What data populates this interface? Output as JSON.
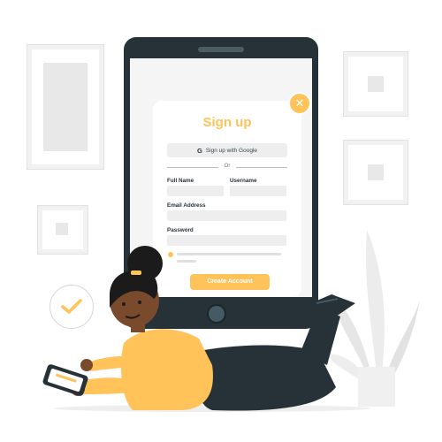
{
  "signup": {
    "title": "Sign up",
    "close_symbol": "✕",
    "google_button_label": "Sign up with Google",
    "google_icon_letter": "G",
    "divider_text": "Or",
    "full_name_label": "Full Name",
    "username_label": "Username",
    "email_label": "Email Address",
    "password_label": "Password",
    "create_button_label": "Create Account"
  },
  "colors": {
    "accent": "#ffc35a",
    "tablet": "#263238",
    "skin": "#7a4a2c",
    "shirt": "#ffc35a",
    "pants": "#263238"
  },
  "icons": [
    "close-icon",
    "google-icon",
    "checkmark-icon"
  ]
}
